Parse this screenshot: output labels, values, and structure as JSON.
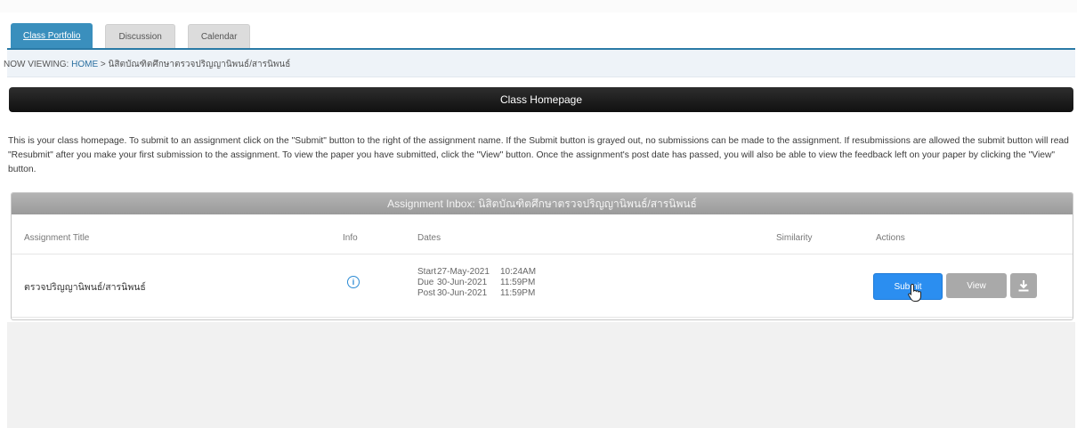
{
  "tabs": [
    {
      "label": "Class Portfolio",
      "active": true
    },
    {
      "label": "Discussion",
      "active": false
    },
    {
      "label": "Calendar",
      "active": false
    }
  ],
  "breadcrumb": {
    "prefix": "NOW VIEWING:",
    "home": "HOME",
    "separator": ">",
    "current": "นิสิตบัณฑิตศึกษาตรวจปริญญานิพนธ์/สารนิพนธ์"
  },
  "page_title": "Class Homepage",
  "intro_text": "This is your class homepage. To submit to an assignment click on the \"Submit\" button to the right of the assignment name. If the Submit button is grayed out, no submissions can be made to the assignment. If resubmissions are allowed the submit button will read \"Resubmit\" after you make your first submission to the assignment. To view the paper you have submitted, click the \"View\" button. Once the assignment's post date has passed, you will also be able to view the feedback left on your paper by clicking the \"View\" button.",
  "inbox": {
    "title": "Assignment Inbox: นิสิตบัณฑิตศึกษาตรวจปริญญานิพนธ์/สารนิพนธ์",
    "columns": {
      "title": "Assignment Title",
      "info": "Info",
      "dates": "Dates",
      "similarity": "Similarity",
      "actions": "Actions"
    },
    "rows": [
      {
        "title": "ตรวจปริญญานิพนธ์/สารนิพนธ์",
        "info_icon": "info-circle-icon",
        "dates": [
          {
            "label": "Start",
            "date": "27-May-2021",
            "time": "10:24AM"
          },
          {
            "label": "Due",
            "date": "30-Jun-2021",
            "time": "11:59PM"
          },
          {
            "label": "Post",
            "date": "30-Jun-2021",
            "time": "11:59PM"
          }
        ],
        "similarity": "",
        "actions": {
          "submit_label": "Submit",
          "view_label": "View",
          "download_icon": "download-icon"
        }
      }
    ]
  },
  "colors": {
    "tab_active": "#3a8fbd",
    "submit_button": "#2b8ef0",
    "title_bar": "#1a1a1a",
    "inbox_header": "#a6a6a6"
  }
}
